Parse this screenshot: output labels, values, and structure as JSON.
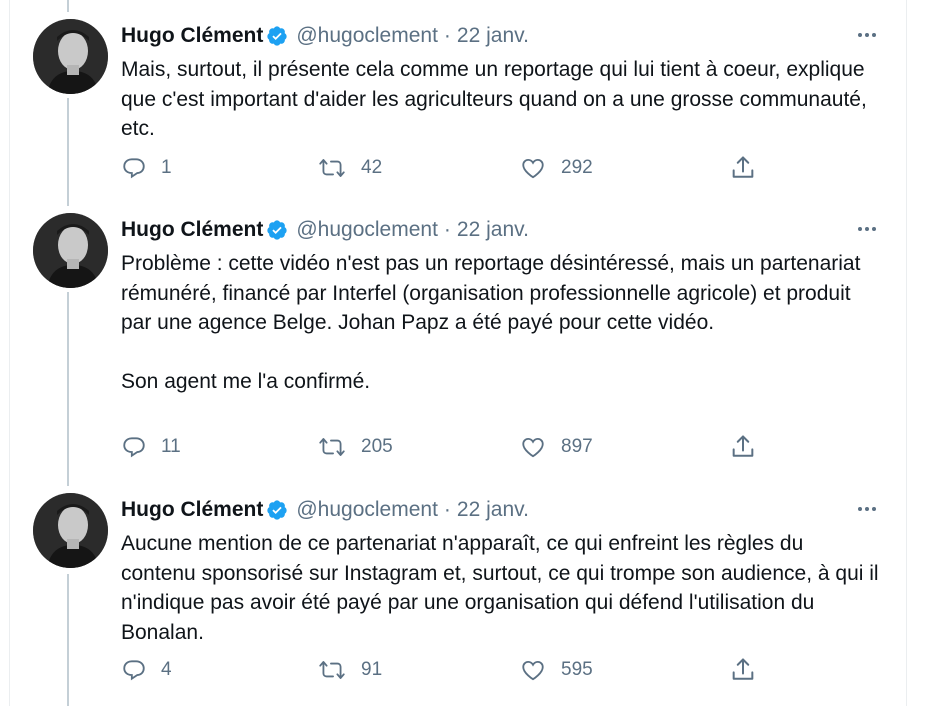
{
  "author": {
    "name": "Hugo Clément",
    "handle": "@hugoclement",
    "separator": "·"
  },
  "icons": {
    "verified": "verified-badge-icon",
    "more": "more-options-icon",
    "reply": "reply-icon",
    "retweet": "retweet-icon",
    "like": "like-icon",
    "share": "share-icon"
  },
  "colors": {
    "verified": "#1da1f2",
    "muted": "#5b7083",
    "text": "#0f1419",
    "thread_line": "#c4cfd6"
  },
  "tweets": [
    {
      "date": "22 janv.",
      "text": "Mais, surtout, il présente cela comme un reportage qui lui tient à coeur, explique que c'est important d'aider les agriculteurs quand on a une grosse communauté, etc.",
      "replies": "1",
      "retweets": "42",
      "likes": "292"
    },
    {
      "date": "22 janv.",
      "text": "Problème : cette vidéo n'est pas un reportage désintéressé, mais un partenariat rémunéré, financé par Interfel (organisation professionnelle agricole) et produit par une agence Belge. Johan Papz a été payé pour cette vidéo.\n\nSon agent me l'a confirmé.",
      "replies": "11",
      "retweets": "205",
      "likes": "897"
    },
    {
      "date": "22 janv.",
      "text": "Aucune mention de ce partenariat n'apparaît, ce qui enfreint les règles du contenu sponsorisé sur Instagram et, surtout, ce qui trompe son audience, à qui il n'indique pas avoir été payé par une organisation qui défend l'utilisation du Bonalan.",
      "replies": "4",
      "retweets": "91",
      "likes": "595"
    }
  ]
}
